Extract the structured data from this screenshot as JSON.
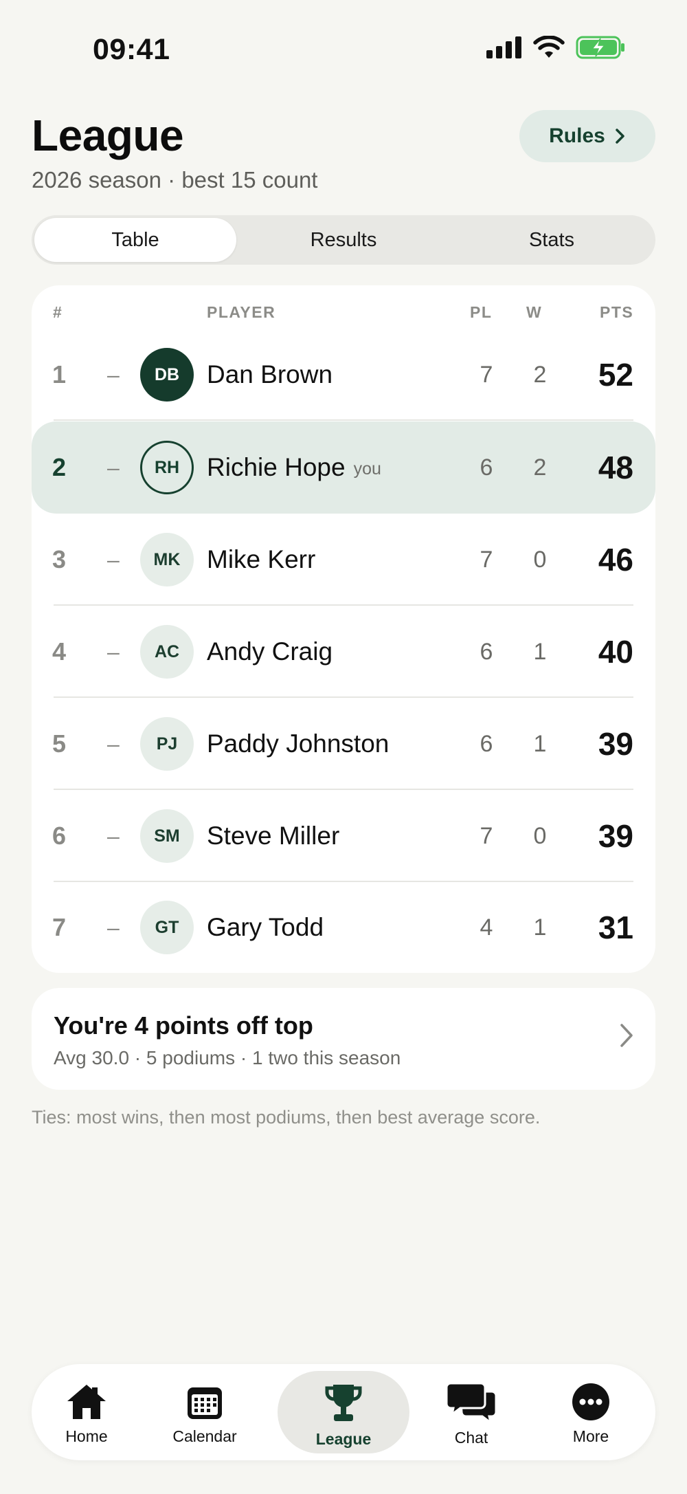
{
  "status_bar": {
    "time": "09:41"
  },
  "header": {
    "title": "League",
    "subtitle": "2026 season · best 15 count",
    "rules_label": "Rules"
  },
  "tabs": [
    {
      "label": "Table",
      "active": true
    },
    {
      "label": "Results",
      "active": false
    },
    {
      "label": "Stats",
      "active": false
    }
  ],
  "table": {
    "columns": {
      "rank": "#",
      "player": "PLAYER",
      "played": "PL",
      "wins": "W",
      "points": "PTS"
    },
    "rows": [
      {
        "rank": "1",
        "trend": "–",
        "initials": "DB",
        "name": "Dan Brown",
        "you": "",
        "pl": "7",
        "w": "2",
        "pts": "52"
      },
      {
        "rank": "2",
        "trend": "–",
        "initials": "RH",
        "name": "Richie Hope",
        "you": "you",
        "pl": "6",
        "w": "2",
        "pts": "48"
      },
      {
        "rank": "3",
        "trend": "–",
        "initials": "MK",
        "name": "Mike Kerr",
        "you": "",
        "pl": "7",
        "w": "0",
        "pts": "46"
      },
      {
        "rank": "4",
        "trend": "–",
        "initials": "AC",
        "name": "Andy Craig",
        "you": "",
        "pl": "6",
        "w": "1",
        "pts": "40"
      },
      {
        "rank": "5",
        "trend": "–",
        "initials": "PJ",
        "name": "Paddy Johnston",
        "you": "",
        "pl": "6",
        "w": "1",
        "pts": "39"
      },
      {
        "rank": "6",
        "trend": "–",
        "initials": "SM",
        "name": "Steve Miller",
        "you": "",
        "pl": "7",
        "w": "0",
        "pts": "39"
      },
      {
        "rank": "7",
        "trend": "–",
        "initials": "GT",
        "name": "Gary Todd",
        "you": "",
        "pl": "4",
        "w": "1",
        "pts": "31"
      }
    ]
  },
  "summary": {
    "title": "You're 4 points off top",
    "subtitle": "Avg 30.0 · 5 podiums · 1 two this season"
  },
  "tie_note": "Ties: most wins, then most podiums, then best average score.",
  "nav": [
    {
      "label": "Home",
      "icon": "home-icon"
    },
    {
      "label": "Calendar",
      "icon": "calendar-icon"
    },
    {
      "label": "League",
      "icon": "trophy-icon",
      "active": true
    },
    {
      "label": "Chat",
      "icon": "chat-icon"
    },
    {
      "label": "More",
      "icon": "more-icon"
    }
  ],
  "colors": {
    "accent": "#16412f",
    "accent_soft": "#e2ebe6",
    "background": "#f6f6f2"
  }
}
